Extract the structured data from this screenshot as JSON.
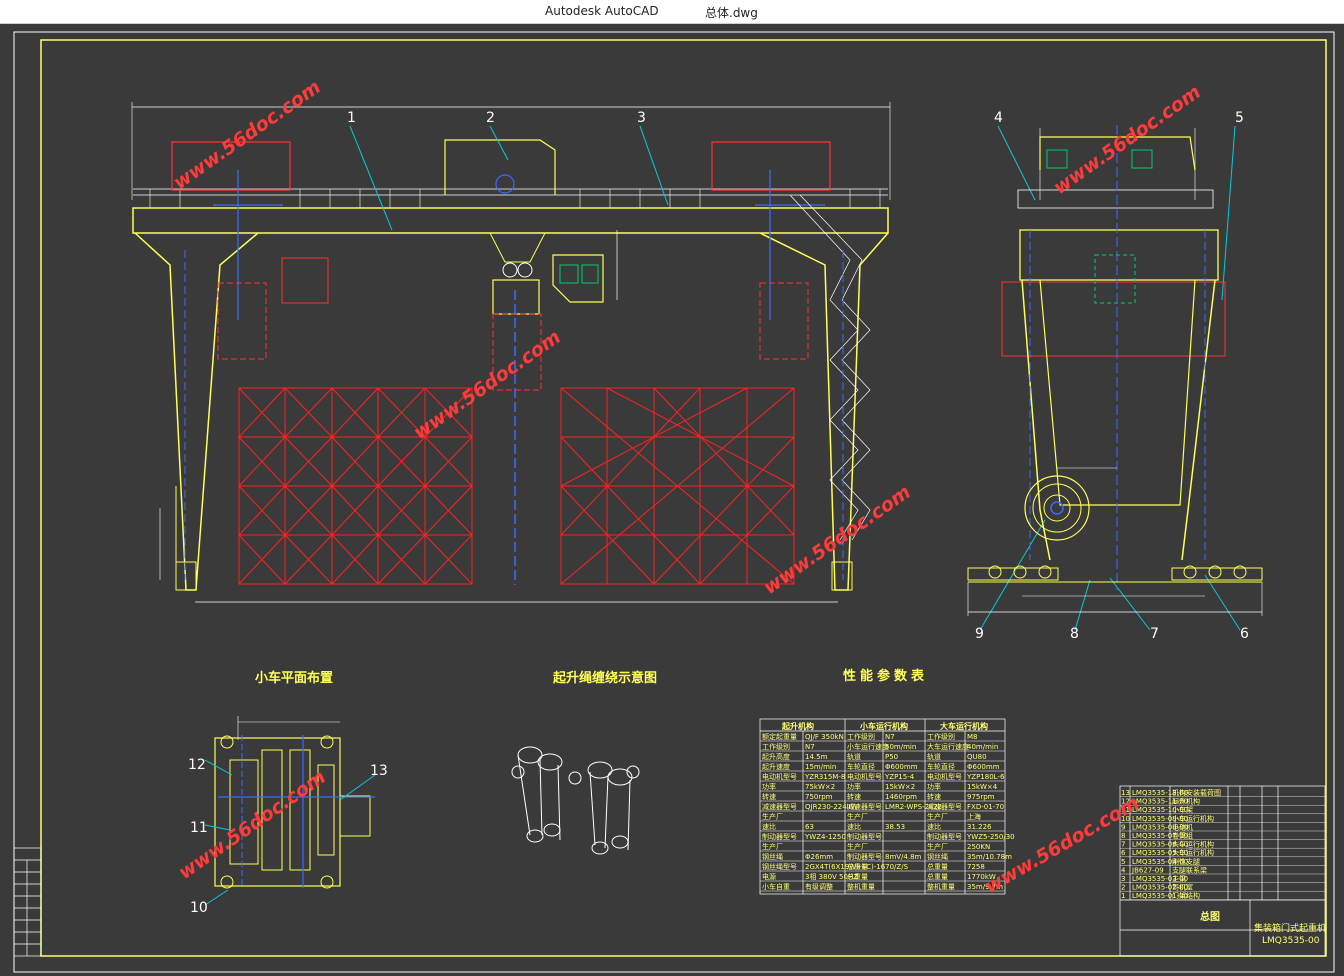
{
  "window": {
    "app_name": "Autodesk AutoCAD",
    "document_name": "总体.dwg"
  },
  "drawing": {
    "section_titles": {
      "trolley_layout": "小车平面布置",
      "hoist_rope": "起升绳缠绕示意图",
      "performance_table": "性能参数表"
    },
    "callouts": [
      "1",
      "2",
      "3",
      "4",
      "5",
      "6",
      "7",
      "8",
      "9",
      "10",
      "11",
      "12",
      "13"
    ],
    "watermark": "www.56doc.com",
    "title_block": {
      "name": "总图",
      "product": "集装箱门式起重机",
      "drawing_no": "LMQ3535-00"
    },
    "perf_table": {
      "headers": [
        "起升机构",
        "小车运行机构",
        "大车运行机构"
      ],
      "rows": [
        [
          "额定起重量",
          "QJ/F 350kN",
          "工作级别",
          "N7",
          "工作级别",
          "M8"
        ],
        [
          "工作级别",
          "N7",
          "小车运行速度",
          "50m/min",
          "大车运行速度",
          "40m/min"
        ],
        [
          "起升高度",
          "14.5m",
          "轨道",
          "P50",
          "轨道",
          "QU80"
        ],
        [
          "起升速度",
          "15m/min",
          "车轮直径",
          "Φ600mm",
          "车轮直径",
          "Φ600mm"
        ],
        [
          "电动机型号",
          "YZR315M-8",
          "电动机型号",
          "YZP15-4",
          "电动机型号",
          "YZP180L-6"
        ],
        [
          "功率",
          "75kW×2",
          "功率",
          "15kW×2",
          "功率",
          "15kW×4"
        ],
        [
          "转速",
          "750rpm",
          "转速",
          "1460rpm",
          "转速",
          "975rpm"
        ],
        [
          "减速器型号",
          "QJR230-224IIW",
          "减速器型号",
          "LMR2-WPS-2k22",
          "减速器型号",
          "FXD-01-70"
        ],
        [
          "生产厂",
          "",
          "生产厂",
          "",
          "生产厂",
          "上海"
        ],
        [
          "速比",
          "63",
          "速比",
          "38.53",
          "速比",
          "31.226"
        ],
        [
          "制动器型号",
          "YWZ4-1250",
          "制动器型号",
          "",
          "制动器型号",
          "YWZ5-250/30"
        ],
        [
          "生产厂",
          "",
          "生产厂",
          "",
          "生产厂",
          "250KN"
        ],
        [
          "钢丝绳",
          "Φ26mm",
          "制动器型号",
          "8mV/4.8m",
          "钢丝绳",
          "35m/10.78m"
        ],
        [
          "钢丝绳型号",
          "2GX4T(6X19W+FC)-1670/Z/S",
          "总重量",
          "",
          "总重量",
          "7258"
        ],
        [
          "电源",
          "3相 380V 50HZ",
          "总重量",
          "",
          "总重量",
          "1770kW"
        ],
        [
          "小车自重",
          "有级调整",
          "整机重量",
          "",
          "整机重量",
          "35m/9.7m"
        ]
      ]
    },
    "parts_list": [
      [
        "13",
        "LMQ3535-13-00",
        "机构安装载荷图"
      ],
      [
        "12",
        "LMQ3535-11-00",
        "起升机构"
      ],
      [
        "11",
        "LMQ3535-10-00",
        "小车架"
      ],
      [
        "10",
        "LMQ3535-09-00",
        "小车运行机构"
      ],
      [
        "9",
        "LMQ3535-08-00",
        "电动机"
      ],
      [
        "8",
        "LMQ3535-07-00",
        "卷筒组"
      ],
      [
        "7",
        "LMQ3535-06-00",
        "大车运行机构"
      ],
      [
        "6",
        "LMQ3535-05-00",
        "大车运行机构"
      ],
      [
        "5",
        "LMQ3535-04-00",
        "刚性支腿"
      ],
      [
        "4",
        "JB627-09",
        "支腿联系梁"
      ],
      [
        "3",
        "LMQ3535-03-00",
        "主梁"
      ],
      [
        "2",
        "LMQ3535-02-00",
        "司机室"
      ],
      [
        "1",
        "LMQ3535-01-00",
        "门架结构"
      ]
    ]
  }
}
